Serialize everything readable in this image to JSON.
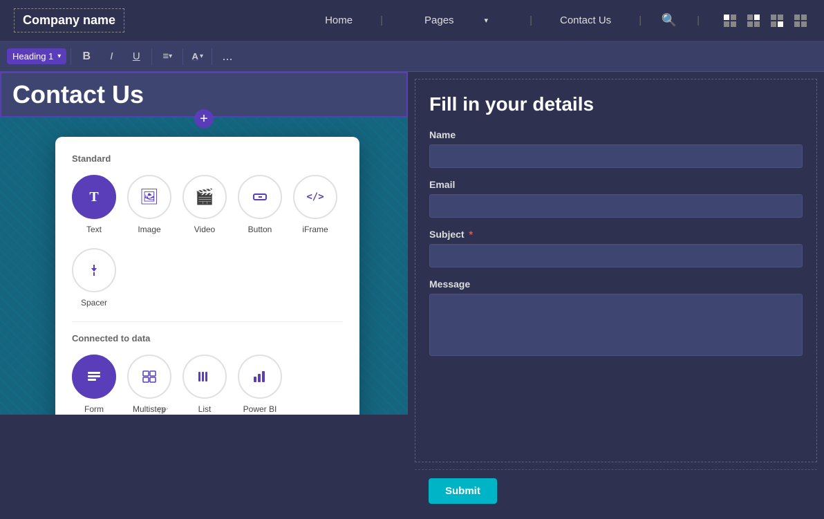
{
  "topnav": {
    "brand": "Company name",
    "links": [
      {
        "label": "Home",
        "id": "home"
      },
      {
        "label": "Pages",
        "id": "pages",
        "hasArrow": true
      },
      {
        "label": "Contact Us",
        "id": "contact"
      }
    ],
    "search_icon": "🔍"
  },
  "toolbar": {
    "heading_select": "Heading 1",
    "bold_label": "B",
    "italic_label": "I",
    "underline_label": "U",
    "align_label": "≡",
    "color_label": "A",
    "more_label": "..."
  },
  "heading": {
    "text": "Contact Us"
  },
  "popup": {
    "standard_label": "Standard",
    "connected_label": "Connected to data",
    "items_standard": [
      {
        "id": "text",
        "label": "Text",
        "icon": "T",
        "active": true
      },
      {
        "id": "image",
        "label": "Image",
        "icon": "🖼"
      },
      {
        "id": "video",
        "label": "Video",
        "icon": "📹"
      },
      {
        "id": "button",
        "label": "Button",
        "icon": "⊡"
      },
      {
        "id": "iframe",
        "label": "iFrame",
        "icon": "</>"
      }
    ],
    "items_spacer": [
      {
        "id": "spacer",
        "label": "Spacer",
        "icon": "↕"
      }
    ],
    "items_connected": [
      {
        "id": "form",
        "label": "Form",
        "icon": "≣",
        "active": true
      },
      {
        "id": "multistep",
        "label": "Multistep form",
        "icon": "⊞"
      },
      {
        "id": "list",
        "label": "List",
        "icon": "|||"
      },
      {
        "id": "powerbi",
        "label": "Power BI",
        "icon": "📊"
      }
    ]
  },
  "form": {
    "title": "Fill in your details",
    "fields": [
      {
        "id": "name",
        "label": "Name",
        "required": false,
        "type": "input"
      },
      {
        "id": "email",
        "label": "Email",
        "required": false,
        "type": "input"
      },
      {
        "id": "subject",
        "label": "Subject",
        "required": true,
        "type": "input"
      },
      {
        "id": "message",
        "label": "Message",
        "required": false,
        "type": "textarea"
      }
    ],
    "submit_label": "Submit"
  }
}
